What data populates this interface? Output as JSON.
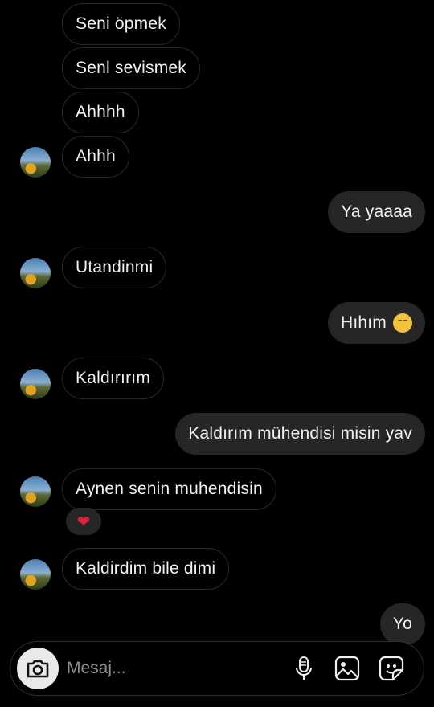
{
  "messages": [
    {
      "text": "Seni öpmek"
    },
    {
      "text": "Senl sevismek"
    },
    {
      "text": "Ahhhh"
    },
    {
      "text": "Ahhh"
    },
    {
      "text": "Ya yaaaa"
    },
    {
      "text": "Utandinmi"
    },
    {
      "text": "Hıhım"
    },
    {
      "text": "Kaldırırım"
    },
    {
      "text": "Kaldırım mühendisi misin yav"
    },
    {
      "text": "Aynen senin muhendisin"
    },
    {
      "text": "Kaldirdim bile dimi"
    },
    {
      "text": "Yo"
    }
  ],
  "reaction": {
    "emoji": "❤"
  },
  "composer": {
    "placeholder": "Mesaj..."
  },
  "icons": [
    "camera-icon",
    "microphone-icon",
    "gallery-icon",
    "sticker-icon",
    "avatar",
    "heart-icon",
    "shy-face-emoji"
  ],
  "colors": {
    "background": "#000000",
    "outgoing_bubble": "#262626",
    "incoming_border": "#2a2a2a",
    "text": "#f2f2f2",
    "placeholder": "#8e8e8e",
    "heart": "#e0203a"
  }
}
